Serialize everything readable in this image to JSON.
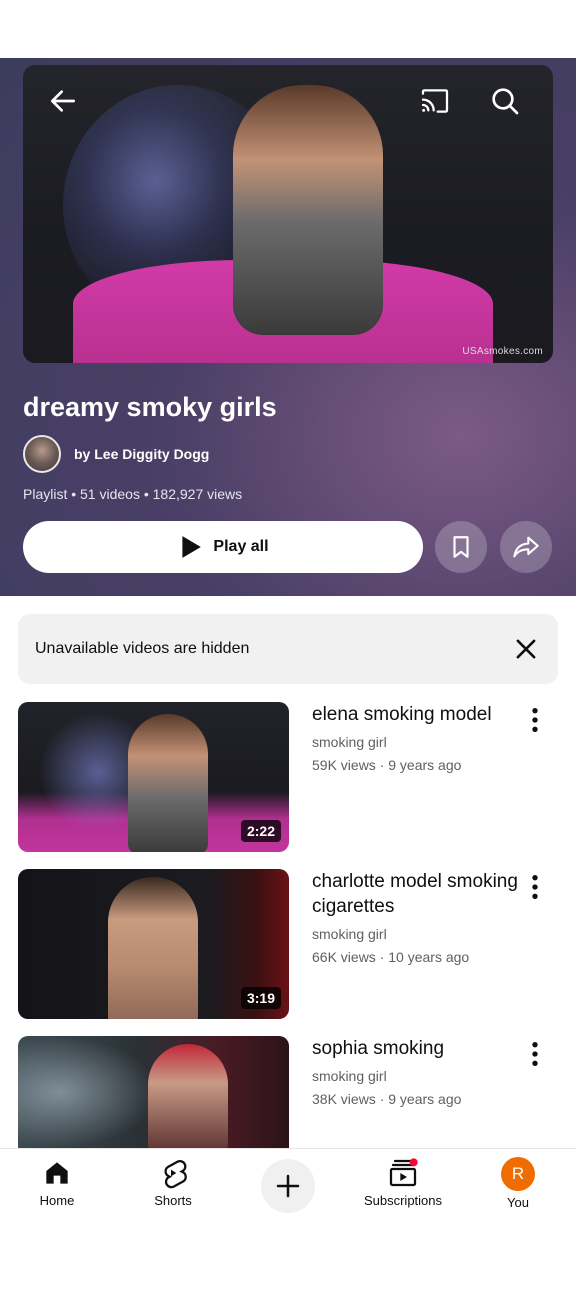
{
  "playlist": {
    "title": "dreamy smoky girls",
    "owner": "by Lee Diggity Dogg",
    "meta": "Playlist • 51 videos • 182,927 views",
    "play_all_label": "Play all",
    "hero_watermark": "USAsmokes.com"
  },
  "top_bar": {
    "back_icon": "arrow-left-icon",
    "cast_icon": "cast-icon",
    "search_icon": "search-icon",
    "more_icon": "more-vert-icon"
  },
  "notice": {
    "text": "Unavailable videos are hidden"
  },
  "videos": [
    {
      "title": "elena smoking model",
      "channel": "smoking girl",
      "stats": "59K views · 9 years ago",
      "duration": "2:22"
    },
    {
      "title": "charlotte model smoking cigarettes",
      "channel": "smoking girl",
      "stats": "66K views · 10 years ago",
      "duration": "3:19"
    },
    {
      "title": "sophia smoking",
      "channel": "smoking girl",
      "stats": "38K views · 9 years ago",
      "duration": ""
    }
  ],
  "bottom_nav": {
    "home": "Home",
    "shorts": "Shorts",
    "subscriptions": "Subscriptions",
    "you": "You",
    "you_initial": "R"
  },
  "colors": {
    "header_bg": "#4a3f66",
    "accent_red": "#ff0033",
    "avatar_orange": "#ef6c00"
  }
}
